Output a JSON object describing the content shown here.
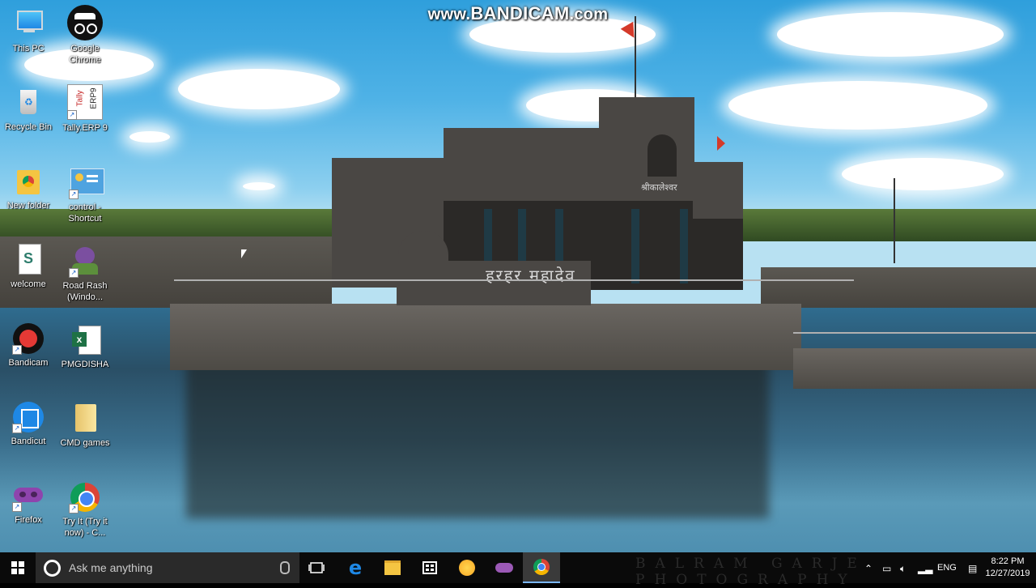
{
  "watermark": {
    "prefix": "www.",
    "brand": "BANDICAM",
    "suffix": ".com"
  },
  "wallpaper": {
    "carving_left": "हरहर महादेव",
    "carving_top": "श्रीकालेश्वर",
    "credit": "BALRAM GARJE PHOTOGRAPHY"
  },
  "desktop_icons": [
    {
      "id": "this-pc",
      "label": "This PC",
      "icon": "computer-icon",
      "shortcut": false
    },
    {
      "id": "google-chrome",
      "label": "Google\nChrome",
      "icon": "incognito-icon",
      "shortcut": true
    },
    {
      "id": "recycle-bin",
      "label": "Recycle Bin",
      "icon": "recycle-bin-icon",
      "shortcut": false
    },
    {
      "id": "tally-erp",
      "label": "Tally.ERP 9",
      "icon": "tally-icon",
      "shortcut": true
    },
    {
      "id": "new-folder",
      "label": "New folder",
      "icon": "chrome-folder-icon",
      "shortcut": false
    },
    {
      "id": "control-shortcut",
      "label": "control -\nShortcut",
      "icon": "control-panel-icon",
      "shortcut": true
    },
    {
      "id": "welcome",
      "label": "welcome",
      "icon": "document-icon",
      "shortcut": false
    },
    {
      "id": "road-rash",
      "label": "Road Rash\n(Windo...",
      "icon": "road-rash-icon",
      "shortcut": true
    },
    {
      "id": "bandicam",
      "label": "Bandicam",
      "icon": "bandicam-icon",
      "shortcut": true
    },
    {
      "id": "pmgdisha",
      "label": "PMGDISHA",
      "icon": "excel-icon",
      "shortcut": false
    },
    {
      "id": "bandicut",
      "label": "Bandicut",
      "icon": "bandicut-icon",
      "shortcut": true
    },
    {
      "id": "cmd-games",
      "label": "CMD games",
      "icon": "folder-icon",
      "shortcut": false
    },
    {
      "id": "firefox",
      "label": "Firefox",
      "icon": "mask-icon",
      "shortcut": true
    },
    {
      "id": "try-it",
      "label": "Try It (Try it\nnow) - C...",
      "icon": "chrome-icon",
      "shortcut": true
    }
  ],
  "taskbar": {
    "search_placeholder": "Ask me anything",
    "apps": [
      "task-view-icon",
      "edge-icon",
      "file-explorer-icon",
      "store-icon",
      "yellow-app-icon",
      "purple-app-icon",
      "chrome-icon"
    ],
    "active_app": "chrome-icon",
    "tray": {
      "language": "ENG",
      "time": "8:22 PM",
      "date": "12/27/2019"
    }
  }
}
